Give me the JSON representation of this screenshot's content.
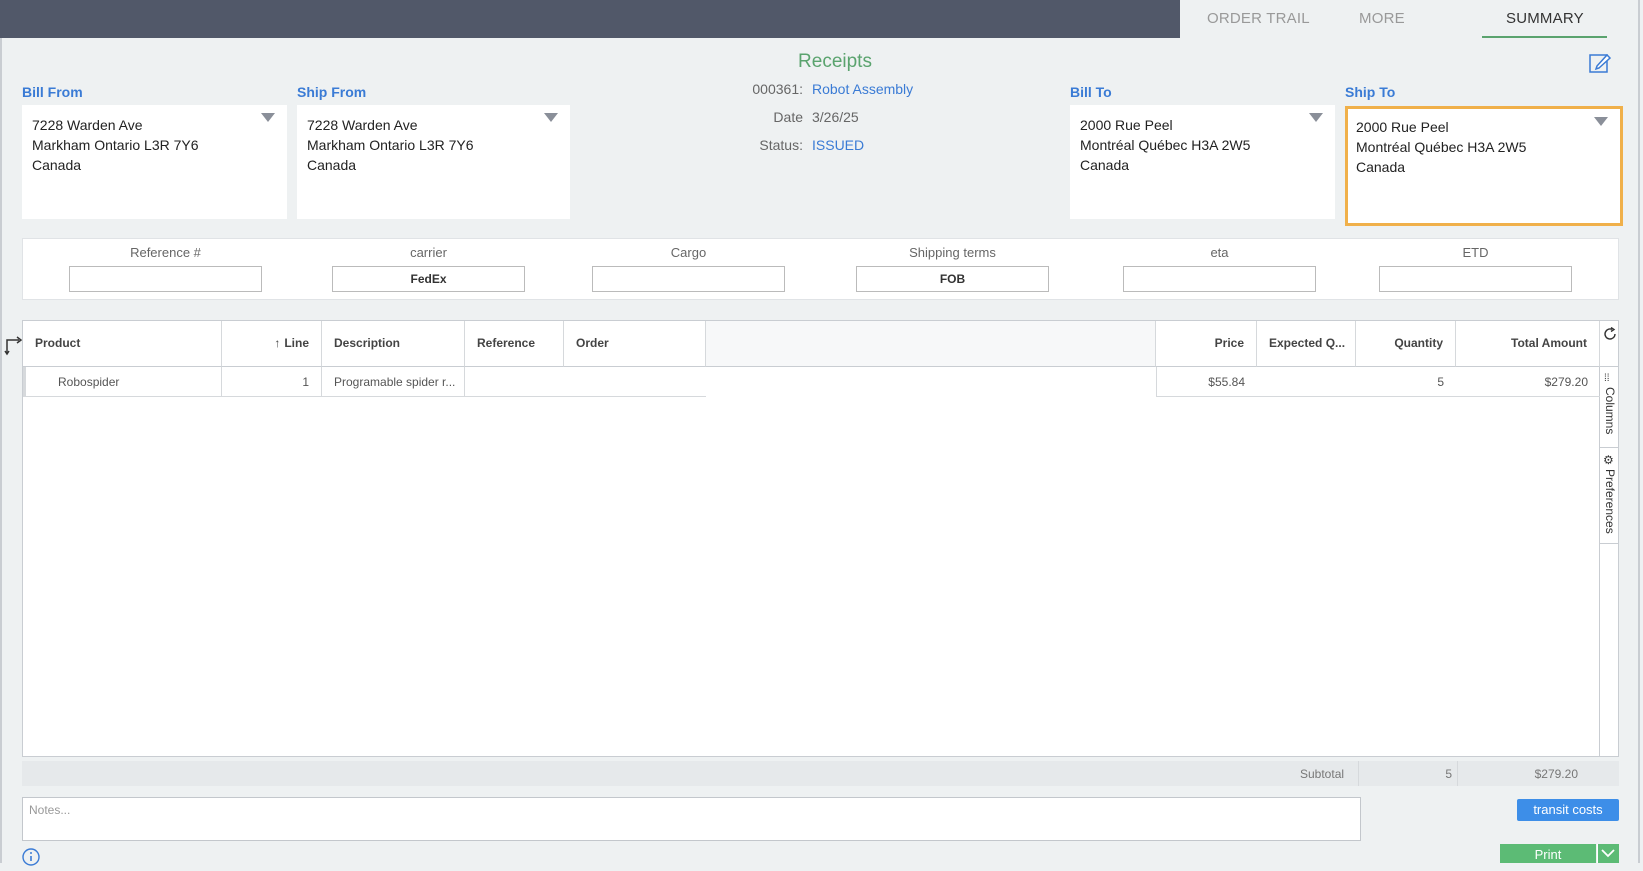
{
  "tabs": [
    {
      "label": "ORDER TRAIL"
    },
    {
      "label": "MORE"
    },
    {
      "label": "SUMMARY"
    }
  ],
  "header": {
    "title": "Receipts",
    "order_number": "000361:",
    "order_name": "Robot Assembly",
    "date_label": "Date",
    "date_value": "3/26/25",
    "status_label": "Status:",
    "status_value": "ISSUED"
  },
  "addresses": {
    "bill_from": {
      "label": "Bill From",
      "line1": "7228 Warden Ave",
      "line2": "Markham Ontario L3R 7Y6",
      "line3": "Canada"
    },
    "ship_from": {
      "label": "Ship From",
      "line1": "7228 Warden Ave",
      "line2": "Markham Ontario L3R 7Y6",
      "line3": "Canada"
    },
    "bill_to": {
      "label": "Bill To",
      "line1": "2000 Rue Peel",
      "line2": "Montréal Québec H3A 2W5",
      "line3": "Canada"
    },
    "ship_to": {
      "label": "Ship To",
      "line1": "2000 Rue Peel",
      "line2": "Montréal Québec H3A 2W5",
      "line3": "Canada"
    }
  },
  "shipping": {
    "reference": {
      "label": "Reference #",
      "value": ""
    },
    "carrier": {
      "label": "carrier",
      "value": "FedEx"
    },
    "cargo": {
      "label": "Cargo",
      "value": ""
    },
    "terms": {
      "label": "Shipping terms",
      "value": "FOB"
    },
    "eta": {
      "label": "eta",
      "value": ""
    },
    "etd": {
      "label": "ETD",
      "value": ""
    }
  },
  "grid": {
    "columns": {
      "product": "Product",
      "line": "Line",
      "description": "Description",
      "reference": "Reference",
      "order": "Order",
      "price": "Price",
      "expected": "Expected Q...",
      "quantity": "Quantity",
      "total": "Total Amount"
    },
    "rows": [
      {
        "product": "Robospider",
        "line": "1",
        "description": "Programable spider r...",
        "reference": "",
        "order": "",
        "price": "$55.84",
        "expected": "",
        "quantity": "5",
        "total": "$279.20"
      }
    ],
    "side": {
      "columns": "Columns",
      "preferences": "Preferences"
    }
  },
  "subtotal": {
    "label": "Subtotal",
    "quantity": "5",
    "total": "$279.20"
  },
  "notes": {
    "placeholder": "Notes..."
  },
  "buttons": {
    "transit": "transit costs",
    "print": "Print"
  },
  "colors": {
    "accent_green": "#5aa36e",
    "link_blue": "#3a7bd5",
    "selection_orange": "#f0b04a",
    "topbar": "#515869"
  }
}
